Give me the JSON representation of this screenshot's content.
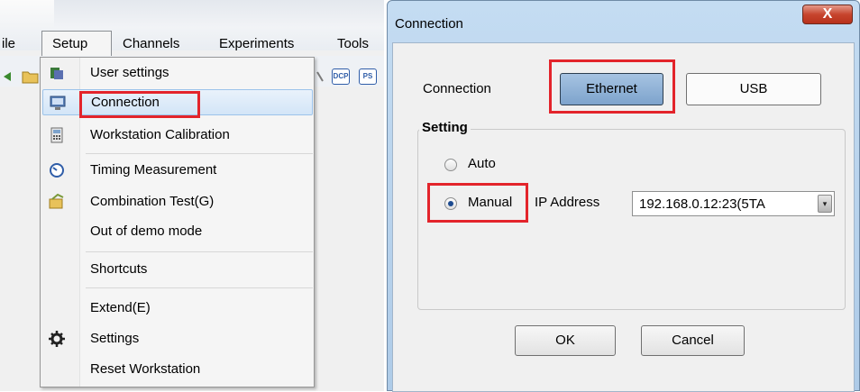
{
  "menubar": {
    "items": [
      "ile",
      "Setup",
      "Channels",
      "Experiments",
      "Tools"
    ]
  },
  "toolbar": {
    "icons": [
      "folder-icon",
      "dcp-icon",
      "ps-icon"
    ],
    "dcp_label": "DCP",
    "ps_label": "PS"
  },
  "setup_menu": {
    "items": [
      {
        "label": "User settings",
        "icon": "user-settings-icon"
      },
      {
        "label": "Connection",
        "icon": "connection-icon"
      },
      {
        "label": "Workstation Calibration",
        "icon": "calculator-icon"
      },
      {
        "label": "Timing Measurement",
        "icon": "timer-icon"
      },
      {
        "label": "Combination Test(G)",
        "icon": "combination-test-icon"
      },
      {
        "label": "Out of demo mode",
        "icon": ""
      },
      {
        "label": "Shortcuts",
        "icon": ""
      },
      {
        "label": "Extend(E)",
        "icon": ""
      },
      {
        "label": "Settings",
        "icon": "gear-icon"
      },
      {
        "label": "Reset Workstation",
        "icon": ""
      }
    ],
    "hover_item": "Connection"
  },
  "dialog": {
    "title": "Connection",
    "close_label": "X",
    "connection_label": "Connection",
    "connection_options": [
      "Ethernet",
      "USB"
    ],
    "selected_connection": "Ethernet",
    "setting_group_title": "Setting",
    "mode_options": [
      "Auto",
      "Manual"
    ],
    "selected_mode": "Manual",
    "ip_label": "IP Address",
    "ip_value": "192.168.0.12:23(5TA",
    "ok_label": "OK",
    "cancel_label": "Cancel"
  },
  "colors": {
    "highlight_red": "#e3242b",
    "menu_hover": "#d3e5f7",
    "ethernet_selected": "#8eb1d8"
  }
}
